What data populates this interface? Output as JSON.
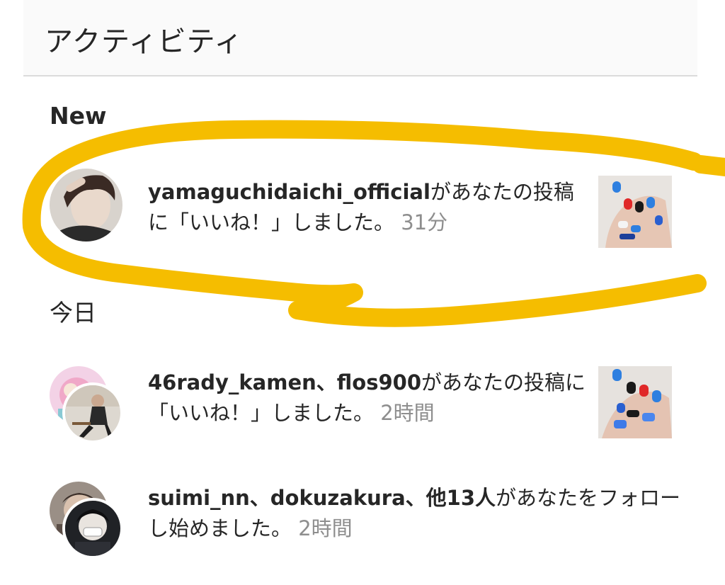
{
  "header": {
    "title": "アクティビティ"
  },
  "sections": {
    "new": "New",
    "today": "今日"
  },
  "items": [
    {
      "users": "yamaguchidaichi_official",
      "message": "があなたの投稿に「いいね！」しました。",
      "time": "31分"
    },
    {
      "users": "46rady_kamen、flos900",
      "message": "があなたの投稿に「いいね！」しました。",
      "time": "2時間"
    },
    {
      "users": "suimi_nn、dokuzakura、他13人",
      "message": "があなたをフォローし始めました。",
      "time": "2時間"
    }
  ],
  "colors": {
    "highlight": "#f5bd00",
    "text": "#262626",
    "secondary": "#8e8e8e",
    "divider": "#dbdbdb"
  },
  "icons": [
    "avatar-photo",
    "post-thumbnail-nails"
  ]
}
